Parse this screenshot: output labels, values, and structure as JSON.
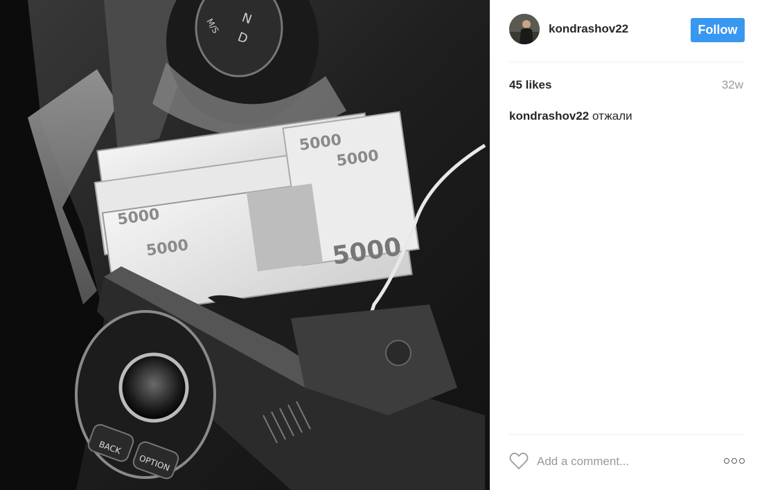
{
  "post": {
    "username": "kondrashov22",
    "follow_label": "Follow",
    "likes": "45 likes",
    "age": "32w",
    "caption_user": "kondrashov22",
    "caption_text": "отжали",
    "comment_placeholder": "Add a comment...",
    "more_icon": "more-options-icon",
    "heart_icon": "heart-icon"
  },
  "photo": {
    "banknote_labels": [
      "5000",
      "5000",
      "5000",
      "5000",
      "5000"
    ],
    "button_labels": [
      "BACK",
      "OPTION"
    ],
    "gear_letters": [
      "N",
      "D",
      "M/S"
    ]
  },
  "colors": {
    "follow_button": "#3897f0",
    "text": "#262626",
    "muted": "#999999",
    "divider": "#efefef"
  }
}
